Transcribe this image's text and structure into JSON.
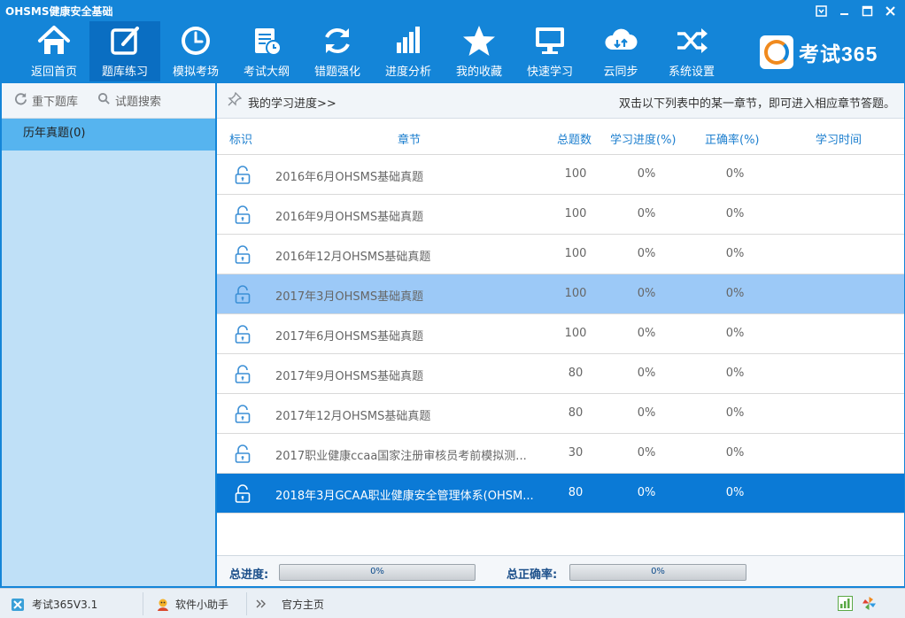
{
  "window": {
    "title": "OHSMS健康安全基础",
    "controls": [
      "restore-down",
      "minimize",
      "maximize",
      "close"
    ]
  },
  "toolbar": {
    "items": [
      {
        "label": "返回首页",
        "icon": "home-icon"
      },
      {
        "label": "题库练习",
        "icon": "edit-icon",
        "active": true
      },
      {
        "label": "模拟考场",
        "icon": "clock-icon"
      },
      {
        "label": "考试大纲",
        "icon": "syllabus-icon"
      },
      {
        "label": "错题强化",
        "icon": "refresh-icon"
      },
      {
        "label": "进度分析",
        "icon": "bar-chart-icon"
      },
      {
        "label": "我的收藏",
        "icon": "star-icon"
      },
      {
        "label": "快速学习",
        "icon": "monitor-icon"
      },
      {
        "label": "云同步",
        "icon": "cloud-sync-icon"
      },
      {
        "label": "系统设置",
        "icon": "shuffle-icon"
      }
    ]
  },
  "brand": {
    "text": "考试365"
  },
  "sidebar": {
    "actions": [
      {
        "label": "重下题库",
        "icon": "reload-icon"
      },
      {
        "label": "试题搜索",
        "icon": "search-icon"
      }
    ],
    "items": [
      {
        "label": "历年真题(0)",
        "selected": true
      }
    ]
  },
  "main": {
    "progress_link": "我的学习进度>>",
    "hint": "双击以下列表中的某一章节，即可进入相应章节答题。",
    "columns": {
      "mark": "标识",
      "chapter": "章节",
      "total": "总题数",
      "progress": "学习进度(%)",
      "accuracy": "正确率(%)",
      "time": "学习时间"
    },
    "rows": [
      {
        "chapter": "2016年6月OHSMS基础真题",
        "total": "100",
        "progress": "0%",
        "accuracy": "0%",
        "time": ""
      },
      {
        "chapter": "2016年9月OHSMS基础真题",
        "total": "100",
        "progress": "0%",
        "accuracy": "0%",
        "time": ""
      },
      {
        "chapter": "2016年12月OHSMS基础真题",
        "total": "100",
        "progress": "0%",
        "accuracy": "0%",
        "time": ""
      },
      {
        "chapter": "2017年3月OHSMS基础真题",
        "total": "100",
        "progress": "0%",
        "accuracy": "0%",
        "time": "",
        "state": "hover"
      },
      {
        "chapter": "2017年6月OHSMS基础真题",
        "total": "100",
        "progress": "0%",
        "accuracy": "0%",
        "time": ""
      },
      {
        "chapter": "2017年9月OHSMS基础真题",
        "total": "80",
        "progress": "0%",
        "accuracy": "0%",
        "time": ""
      },
      {
        "chapter": "2017年12月OHSMS基础真题",
        "total": "80",
        "progress": "0%",
        "accuracy": "0%",
        "time": ""
      },
      {
        "chapter": "2017职业健康ccaa国家注册审核员考前模拟测...",
        "total": "30",
        "progress": "0%",
        "accuracy": "0%",
        "time": ""
      },
      {
        "chapter": "2018年3月GCAA职业健康安全管理体系(OHSM...",
        "total": "80",
        "progress": "0%",
        "accuracy": "0%",
        "time": "",
        "state": "selected"
      }
    ],
    "summary": {
      "total_progress_label": "总进度:",
      "total_progress_value": "0%",
      "total_progress_fraction": 0,
      "total_accuracy_label": "总正确率:",
      "total_accuracy_value": "0%",
      "total_accuracy_fraction": 0
    }
  },
  "statusbar": {
    "version": "考试365V3.1",
    "assistant": "软件小助手",
    "homepage": "官方主页"
  },
  "colors": {
    "accent": "#1485d8",
    "active_tool": "#0a6ec2",
    "sidebar_bg": "#bfe0f7",
    "sidebar_selected": "#56b4ef",
    "row_hover": "#9cc9f7",
    "row_selected": "#0b7ad6",
    "header_text": "#1d7fcf",
    "brand_orange": "#f08a1e"
  }
}
